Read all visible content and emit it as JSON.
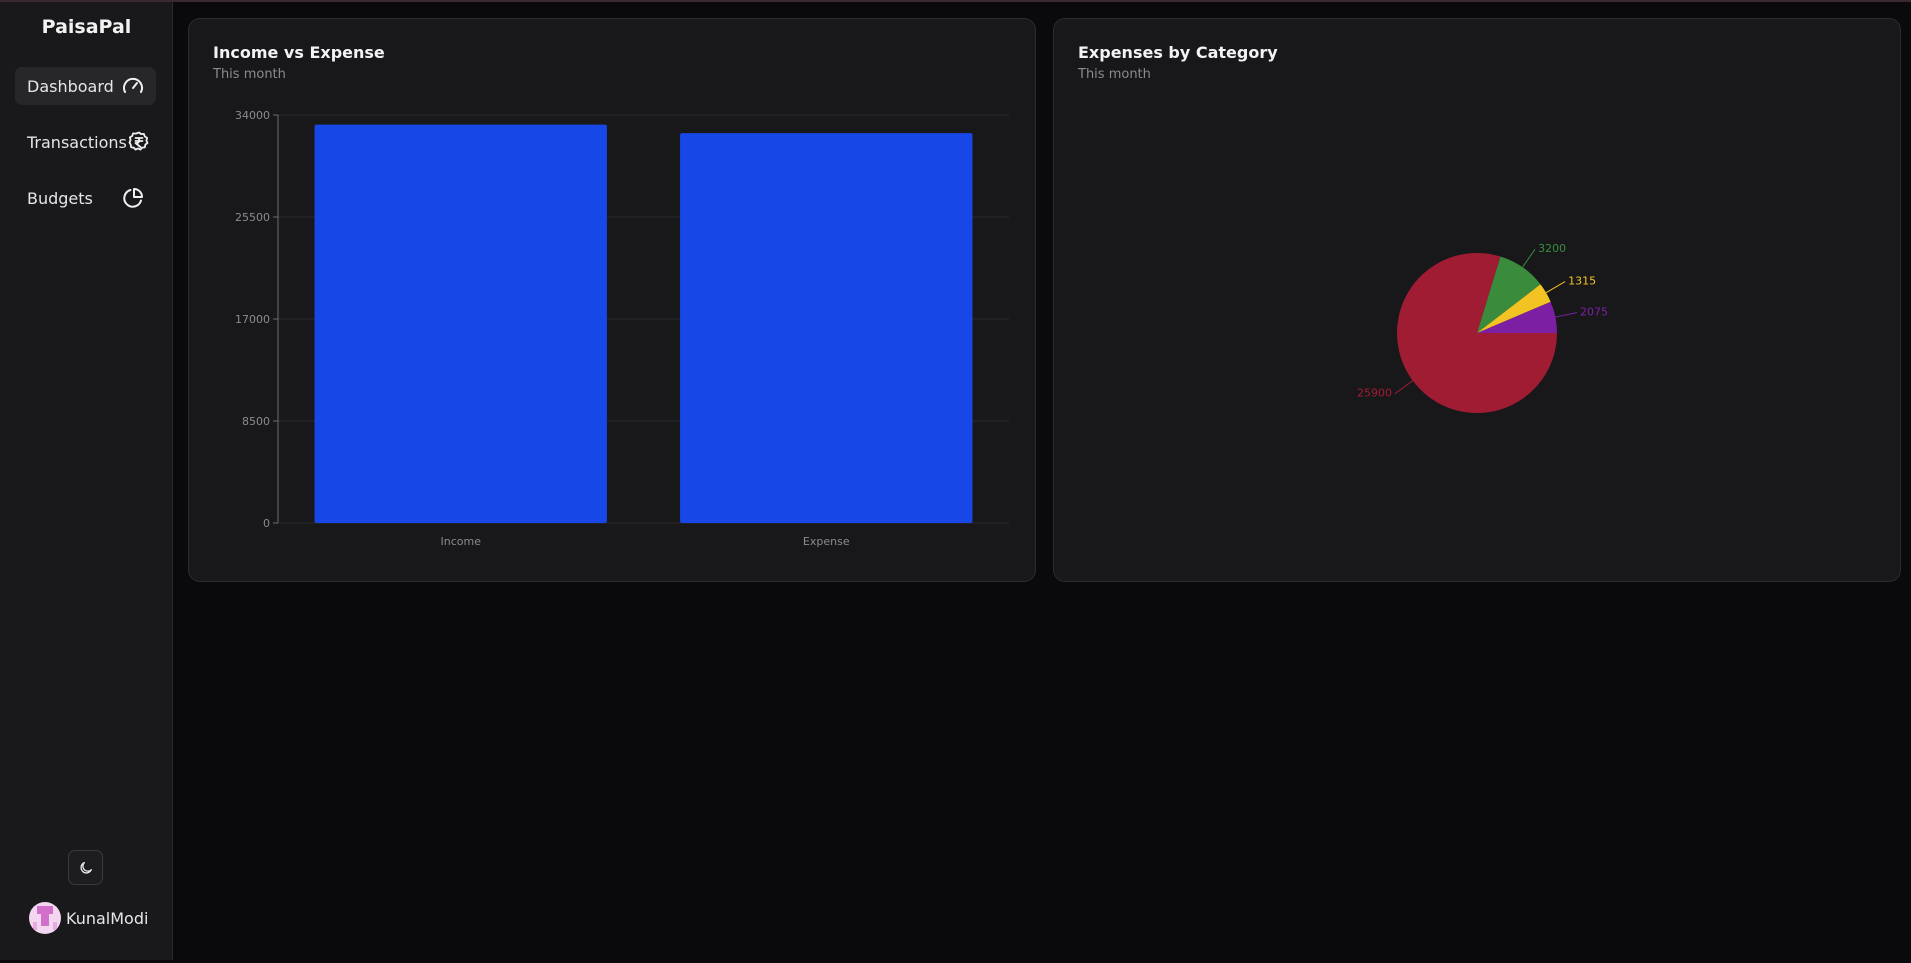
{
  "app": {
    "brand": "PaisaPal"
  },
  "sidebar": {
    "items": [
      {
        "label": "Dashboard",
        "icon": "gauge-icon",
        "active": true
      },
      {
        "label": "Transactions",
        "icon": "rupee-badge-icon",
        "active": false
      },
      {
        "label": "Budgets",
        "icon": "pie-chart-icon",
        "active": false
      }
    ],
    "theme_toggle_icon": "moon-icon",
    "user": {
      "name": "KunalModi"
    }
  },
  "cards": {
    "income_expense": {
      "title": "Income vs Expense",
      "subtitle": "This month"
    },
    "expenses_category": {
      "title": "Expenses by Category",
      "subtitle": "This month"
    }
  },
  "colors": {
    "bar": "#1747e6",
    "text_muted": "#8a8a90",
    "card_bg": "#18181b"
  },
  "chart_data": [
    {
      "type": "bar",
      "categories": [
        "Income",
        "Expense"
      ],
      "values": [
        33200,
        32490
      ],
      "ylim": [
        0,
        34000
      ],
      "yticks": [
        0,
        8500,
        17000,
        25500,
        34000
      ],
      "grid": true,
      "color": "#1747e6"
    },
    {
      "type": "pie",
      "slices": [
        {
          "value": 2075,
          "label": "2075",
          "color": "#7d1fa3"
        },
        {
          "value": 1315,
          "label": "1315",
          "color": "#f3c324"
        },
        {
          "value": 3200,
          "label": "3200",
          "color": "#3a8c3c"
        },
        {
          "value": 25900,
          "label": "25900",
          "color": "#a01c33"
        }
      ]
    }
  ]
}
